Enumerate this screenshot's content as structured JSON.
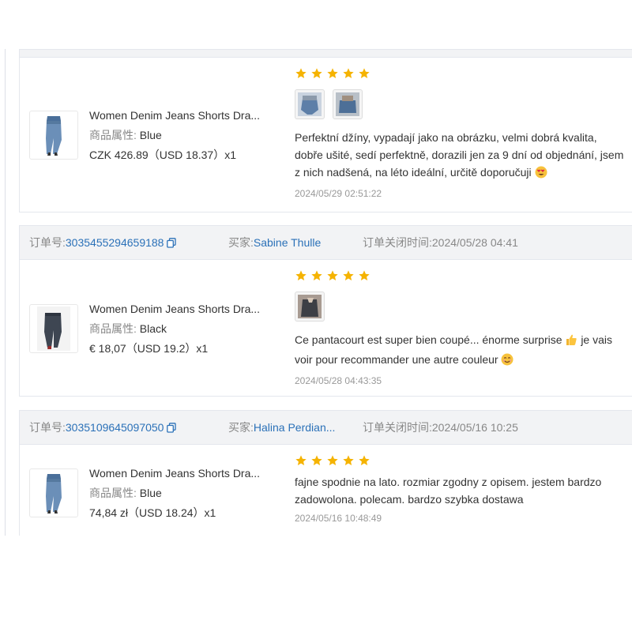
{
  "colors": {
    "accent": "#2b71b8",
    "star": "#f5b301",
    "header_bg": "#f2f3f5"
  },
  "orders": [
    {
      "product": {
        "title": "Women Denim Jeans Shorts Dra...",
        "attr_label": "商品属性:",
        "attr_value": "Blue",
        "price": "CZK 426.89（USD  18.37）x1"
      },
      "review": {
        "rating": 5,
        "photos": [
          "review-photo-1",
          "review-photo-2"
        ],
        "text": "Perfektní džíny, vypadají jako na obrázku, velmi dobrá kvalita, dobře ušité, sedí perfektně, dorazili jen za 9 dní od objednání, jsem z nich nadšená, na léto ideální, určitě doporučuji",
        "emoji": "heart-eyes",
        "time": "2024/05/29 02:51:22"
      }
    },
    {
      "header": {
        "order_label": "订单号:",
        "order_no": "3035455294659188",
        "buyer_label": "买家:",
        "buyer": "Sabine Thulle",
        "closed_label": "订单关闭时间:",
        "closed_time": "2024/05/28 04:41"
      },
      "product": {
        "title": "Women Denim Jeans Shorts Dra...",
        "attr_label": "商品属性:",
        "attr_value": "Black",
        "price": "€ 18,07（USD  19.2）x1"
      },
      "review": {
        "rating": 5,
        "photos": [
          "review-photo-1"
        ],
        "text_before": "Ce pantacourt est super bien coupé... énorme surprise",
        "text_after": "je vais voir pour recommander une autre couleur",
        "emoji_mid": "thumbs-up",
        "emoji_end": "smile",
        "time": "2024/05/28 04:43:35"
      }
    },
    {
      "header": {
        "order_label": "订单号:",
        "order_no": "3035109645097050",
        "buyer_label": "买家:",
        "buyer": "Halina Perdian...",
        "closed_label": "订单关闭时间:",
        "closed_time": "2024/05/16 10:25"
      },
      "product": {
        "title": "Women Denim Jeans Shorts Dra...",
        "attr_label": "商品属性:",
        "attr_value": "Blue",
        "price": "74,84 zł（USD  18.24）x1"
      },
      "review": {
        "rating": 5,
        "photos": [],
        "text": "fajne spodnie na lato. rozmiar zgodny z opisem. jestem bardzo zadowolona. polecam. bardzo szybka dostawa",
        "time": "2024/05/16 10:48:49"
      }
    }
  ]
}
